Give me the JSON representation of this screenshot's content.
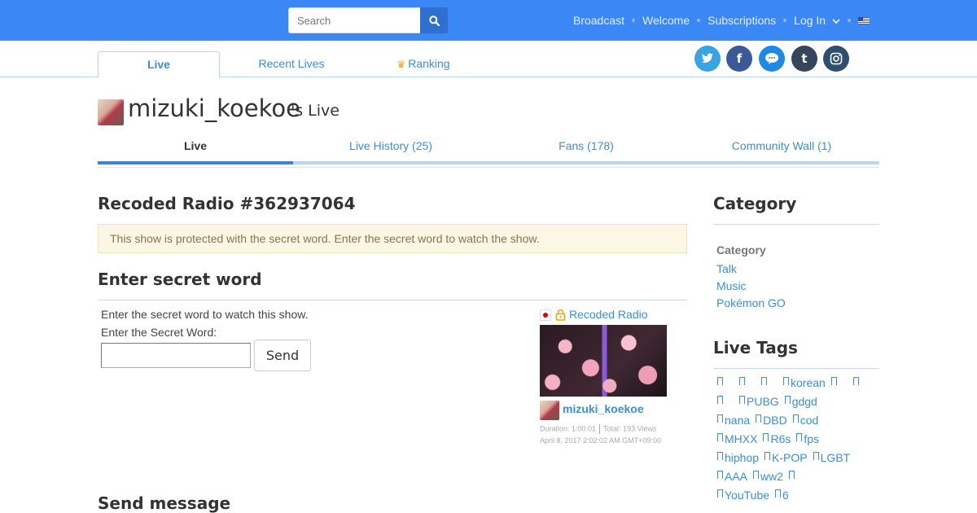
{
  "header": {
    "search_placeholder": "Search",
    "nav": [
      {
        "label": "Broadcast"
      },
      {
        "label": "Welcome"
      },
      {
        "label": "Subscriptions"
      },
      {
        "label": "Log In"
      }
    ],
    "accent": "#3b87f5"
  },
  "main_tabs": [
    {
      "label": "Live"
    },
    {
      "label": "Recent Lives"
    },
    {
      "label": "Ranking"
    }
  ],
  "social": [
    {
      "icon": "twitter-icon",
      "color": "#3aa3e3"
    },
    {
      "icon": "facebook-icon",
      "color": "#3b5998"
    },
    {
      "icon": "line-icon",
      "color": "#1e88e5"
    },
    {
      "icon": "tumblr-icon",
      "color": "#35465c"
    },
    {
      "icon": "instagram-icon",
      "color": "#2f4f6f"
    }
  ],
  "profile": {
    "name": "mizuki_koekoe",
    "suffix": "'s Live"
  },
  "profile_tabs": [
    {
      "label": "Live"
    },
    {
      "label": "Live History (25)"
    },
    {
      "label": "Fans (178)"
    },
    {
      "label": "Community Wall (1)"
    }
  ],
  "show": {
    "title": "Recoded Radio #362937064",
    "alert": "This show is protected with the secret word. Enter the secret word to watch the show.",
    "enter_title": "Enter secret word",
    "instruction": "Enter the secret word to watch this show.",
    "field_label": "Enter the Secret Word:",
    "send_label": "Send",
    "send_message_title": "Send message"
  },
  "card": {
    "title": "Recoded Radio",
    "user": "mizuki_koekoe",
    "duration": "Duration: 1:00:01",
    "views": "Total: 193 Views",
    "date": "April 8, 2017 2:02:02 AM GMT+09:00"
  },
  "sidebar": {
    "category_title": "Category",
    "category_label": "Category",
    "categories": [
      "Talk",
      "Music",
      "Pokémon GO"
    ],
    "tags_title": "Live Tags",
    "tag_rows": [
      [
        "",
        "",
        "",
        "korean",
        "",
        ""
      ],
      [
        "",
        "PUBG",
        "gdgd"
      ],
      [
        "nana",
        "DBD",
        "cod"
      ],
      [
        "MHXX",
        "R6s",
        "fps"
      ],
      [
        "hiphop",
        "K-POP",
        "LGBT"
      ],
      [
        "AAA",
        "ww2",
        ""
      ],
      [
        "YouTube",
        "6"
      ]
    ]
  }
}
